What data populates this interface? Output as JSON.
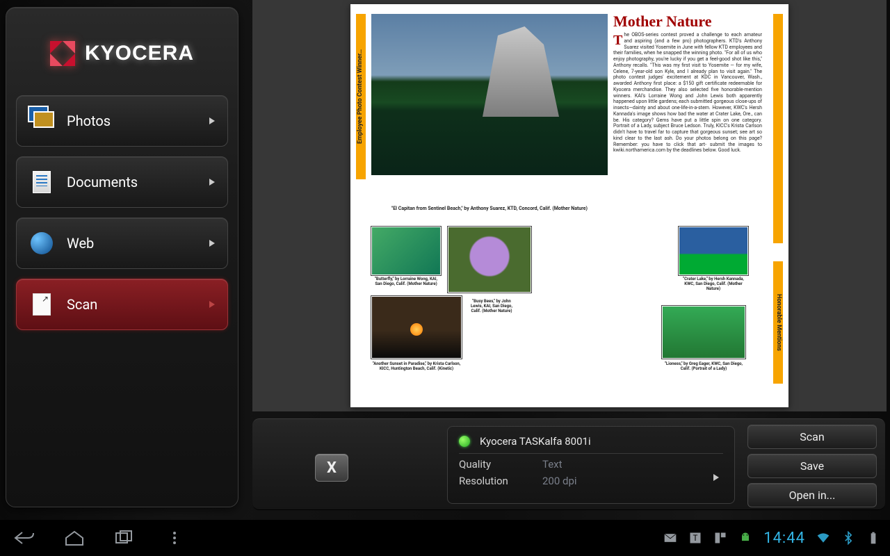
{
  "brand": {
    "name": "KYOCERA"
  },
  "sidebar": {
    "items": [
      {
        "label": "Photos",
        "icon": "photos-icon",
        "active": false
      },
      {
        "label": "Documents",
        "icon": "documents-icon",
        "active": false
      },
      {
        "label": "Web",
        "icon": "web-icon",
        "active": false
      },
      {
        "label": "Scan",
        "icon": "scan-icon",
        "active": true
      }
    ]
  },
  "preview": {
    "document": {
      "headline": "Mother Nature",
      "vertical_left_label": "Employee Photo Contest Winner…",
      "vertical_right_label": "Honorable Mentions",
      "hero_caption": "\"El Capitan from Sentinel Beach,\" by Anthony Suarez, KTD, Concord, Calif. (Mother Nature)",
      "body_text": "The OBOS-series contest proved a challenge to each amateur and aspiring (and a few pro) photographers. KTD's Anthony Suarez visited Yosemite in June with fellow KTD employees and their families, when he snapped the winning photo. \"For all of us who enjoy photography, you're lucky if you get a feel-good shot like this,\" Anthony recalls. \"This was my first visit to Yosemite — for my wife, Celene, 7-year-old son Kyle, and I already plan to visit again.\" The photo contest judges' excitement at KDC in Vancouver, Wash., awarded Anthony first place: a $150 gift certificate redeemable for Kyocera merchandise. They also selected five honorable-mention winners. KAI's Lorraine Wong and John Lewis both apparently happened upon little gardens; each submitted gorgeous close-ups of insects—dainty and about one-life-in-a-stem. However, KWC's Hersh Kannada's image shows how bad the water at Crater Lake, Ore., can be. His category? Gems have put a little spin on one category. Portrait of a Lady, subject Bruce Ledson. Truly, KICC's Krista Carlson didn't have to travel far to capture that gorgeous sunset; see art so kind clear to the last ash. Do your photos belong on this page? Remember: you have to click that art- submit the images to kwiki.northamerica.com by the deadlines below. Good luck.",
      "captions": {
        "butterfly": "\"Butterfly,\" by Lorraine Wong, KAI, San Diego, Calif. (Mother Nature)",
        "crater": "\"Crater Lake,\" by Hersh Kannada, KWC, San Diego, Calif. (Mother Nature)",
        "bees": "\"Busy Bees,\" by John Lewis, KAI, San Diego, Calif. (Mother Nature)",
        "sunset": "\"Another Sunset in Paradise,\" by Krista Carlson, KICC, Huntington Beach, Calif. (Kinetic)",
        "lioness": "\"Lioness,\" by Greg Eager, KWC, San Diego, Calif. (Portrait of a Lady)"
      }
    }
  },
  "controlbar": {
    "close_label": "X",
    "device": {
      "name": "Kyocera TASKalfa 8001i",
      "status": "ok"
    },
    "settings": {
      "quality": {
        "label": "Quality",
        "value": "Text"
      },
      "resolution": {
        "label": "Resolution",
        "value": "200 dpi"
      }
    },
    "actions": {
      "scan": "Scan",
      "save": "Save",
      "open_in": "Open in..."
    }
  },
  "sysbar": {
    "time": "14:44",
    "tray_icons": [
      "mail-icon",
      "text-icon",
      "flipboard-icon",
      "android-icon",
      "wifi-icon",
      "bluetooth-icon",
      "battery-icon"
    ]
  }
}
